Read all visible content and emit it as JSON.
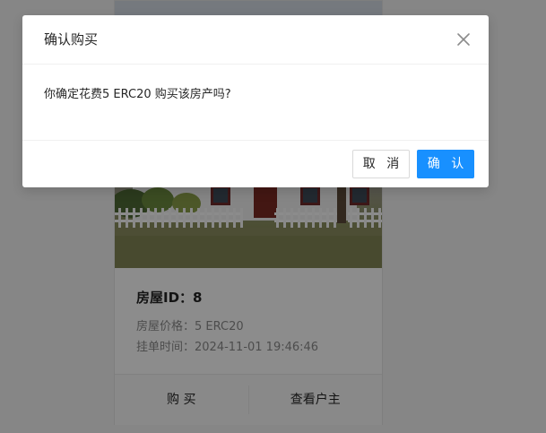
{
  "card": {
    "title": "房屋ID：8",
    "price": "房屋价格：5 ERC20",
    "listed_time": "挂单时间：2024-11-01 19:46:46",
    "buy_label": "购 买",
    "view_owner_label": "查看户主"
  },
  "modal": {
    "title": "确认购买",
    "message": "你确定花费5 ERC20 购买该房产吗?",
    "cancel_label": "取 消",
    "ok_label": "确 认",
    "close_icon": "close-icon"
  },
  "colors": {
    "primary": "#1890ff",
    "mask": "rgba(0,0,0,0.45)"
  }
}
